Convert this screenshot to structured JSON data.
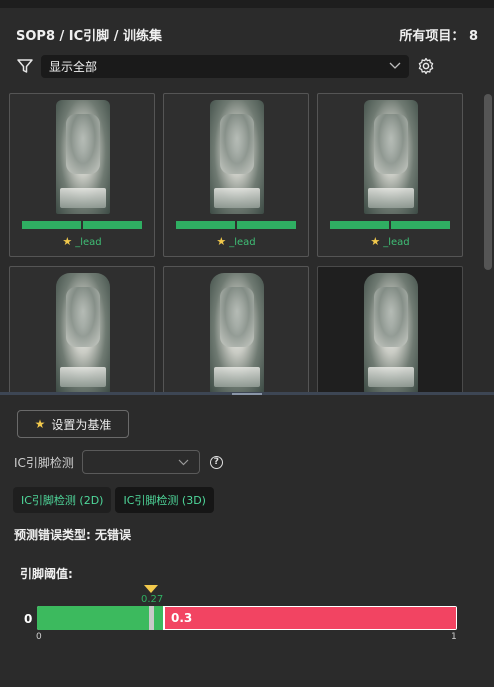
{
  "header": {
    "breadcrumb": "SOP8 / IC引脚 / 训练集",
    "total_items": "所有项目： 8"
  },
  "filter": {
    "icon": "filter-icon",
    "selected": "显示全部",
    "settings_icon": "gear-icon"
  },
  "gallery": {
    "items": [
      {
        "label": "_lead",
        "starred": true
      },
      {
        "label": "_lead",
        "starred": true
      },
      {
        "label": "_lead",
        "starred": true
      },
      {
        "label": "",
        "starred": false
      },
      {
        "label": "",
        "starred": false
      },
      {
        "label": "",
        "starred": false
      }
    ]
  },
  "actions": {
    "set_base_label": "设置为基准"
  },
  "detector": {
    "label": "IC引脚检测",
    "selected": "",
    "help": "?"
  },
  "tabs": [
    {
      "label": "IC引脚检测 (2D)"
    },
    {
      "label": "IC引脚检测 (3D)"
    }
  ],
  "prediction": {
    "text": "预测错误类型: 无错误"
  },
  "threshold": {
    "label": "引脚阈值:",
    "left_value": "0",
    "marker_value": "0.27",
    "marker_fraction": 0.27,
    "threshold_value": "0.3",
    "threshold_fraction": 0.3,
    "range_min": "0",
    "range_max": "1",
    "colors": {
      "below": "#3cba5e",
      "above": "#f24462",
      "marker": "#f2c94c"
    }
  }
}
